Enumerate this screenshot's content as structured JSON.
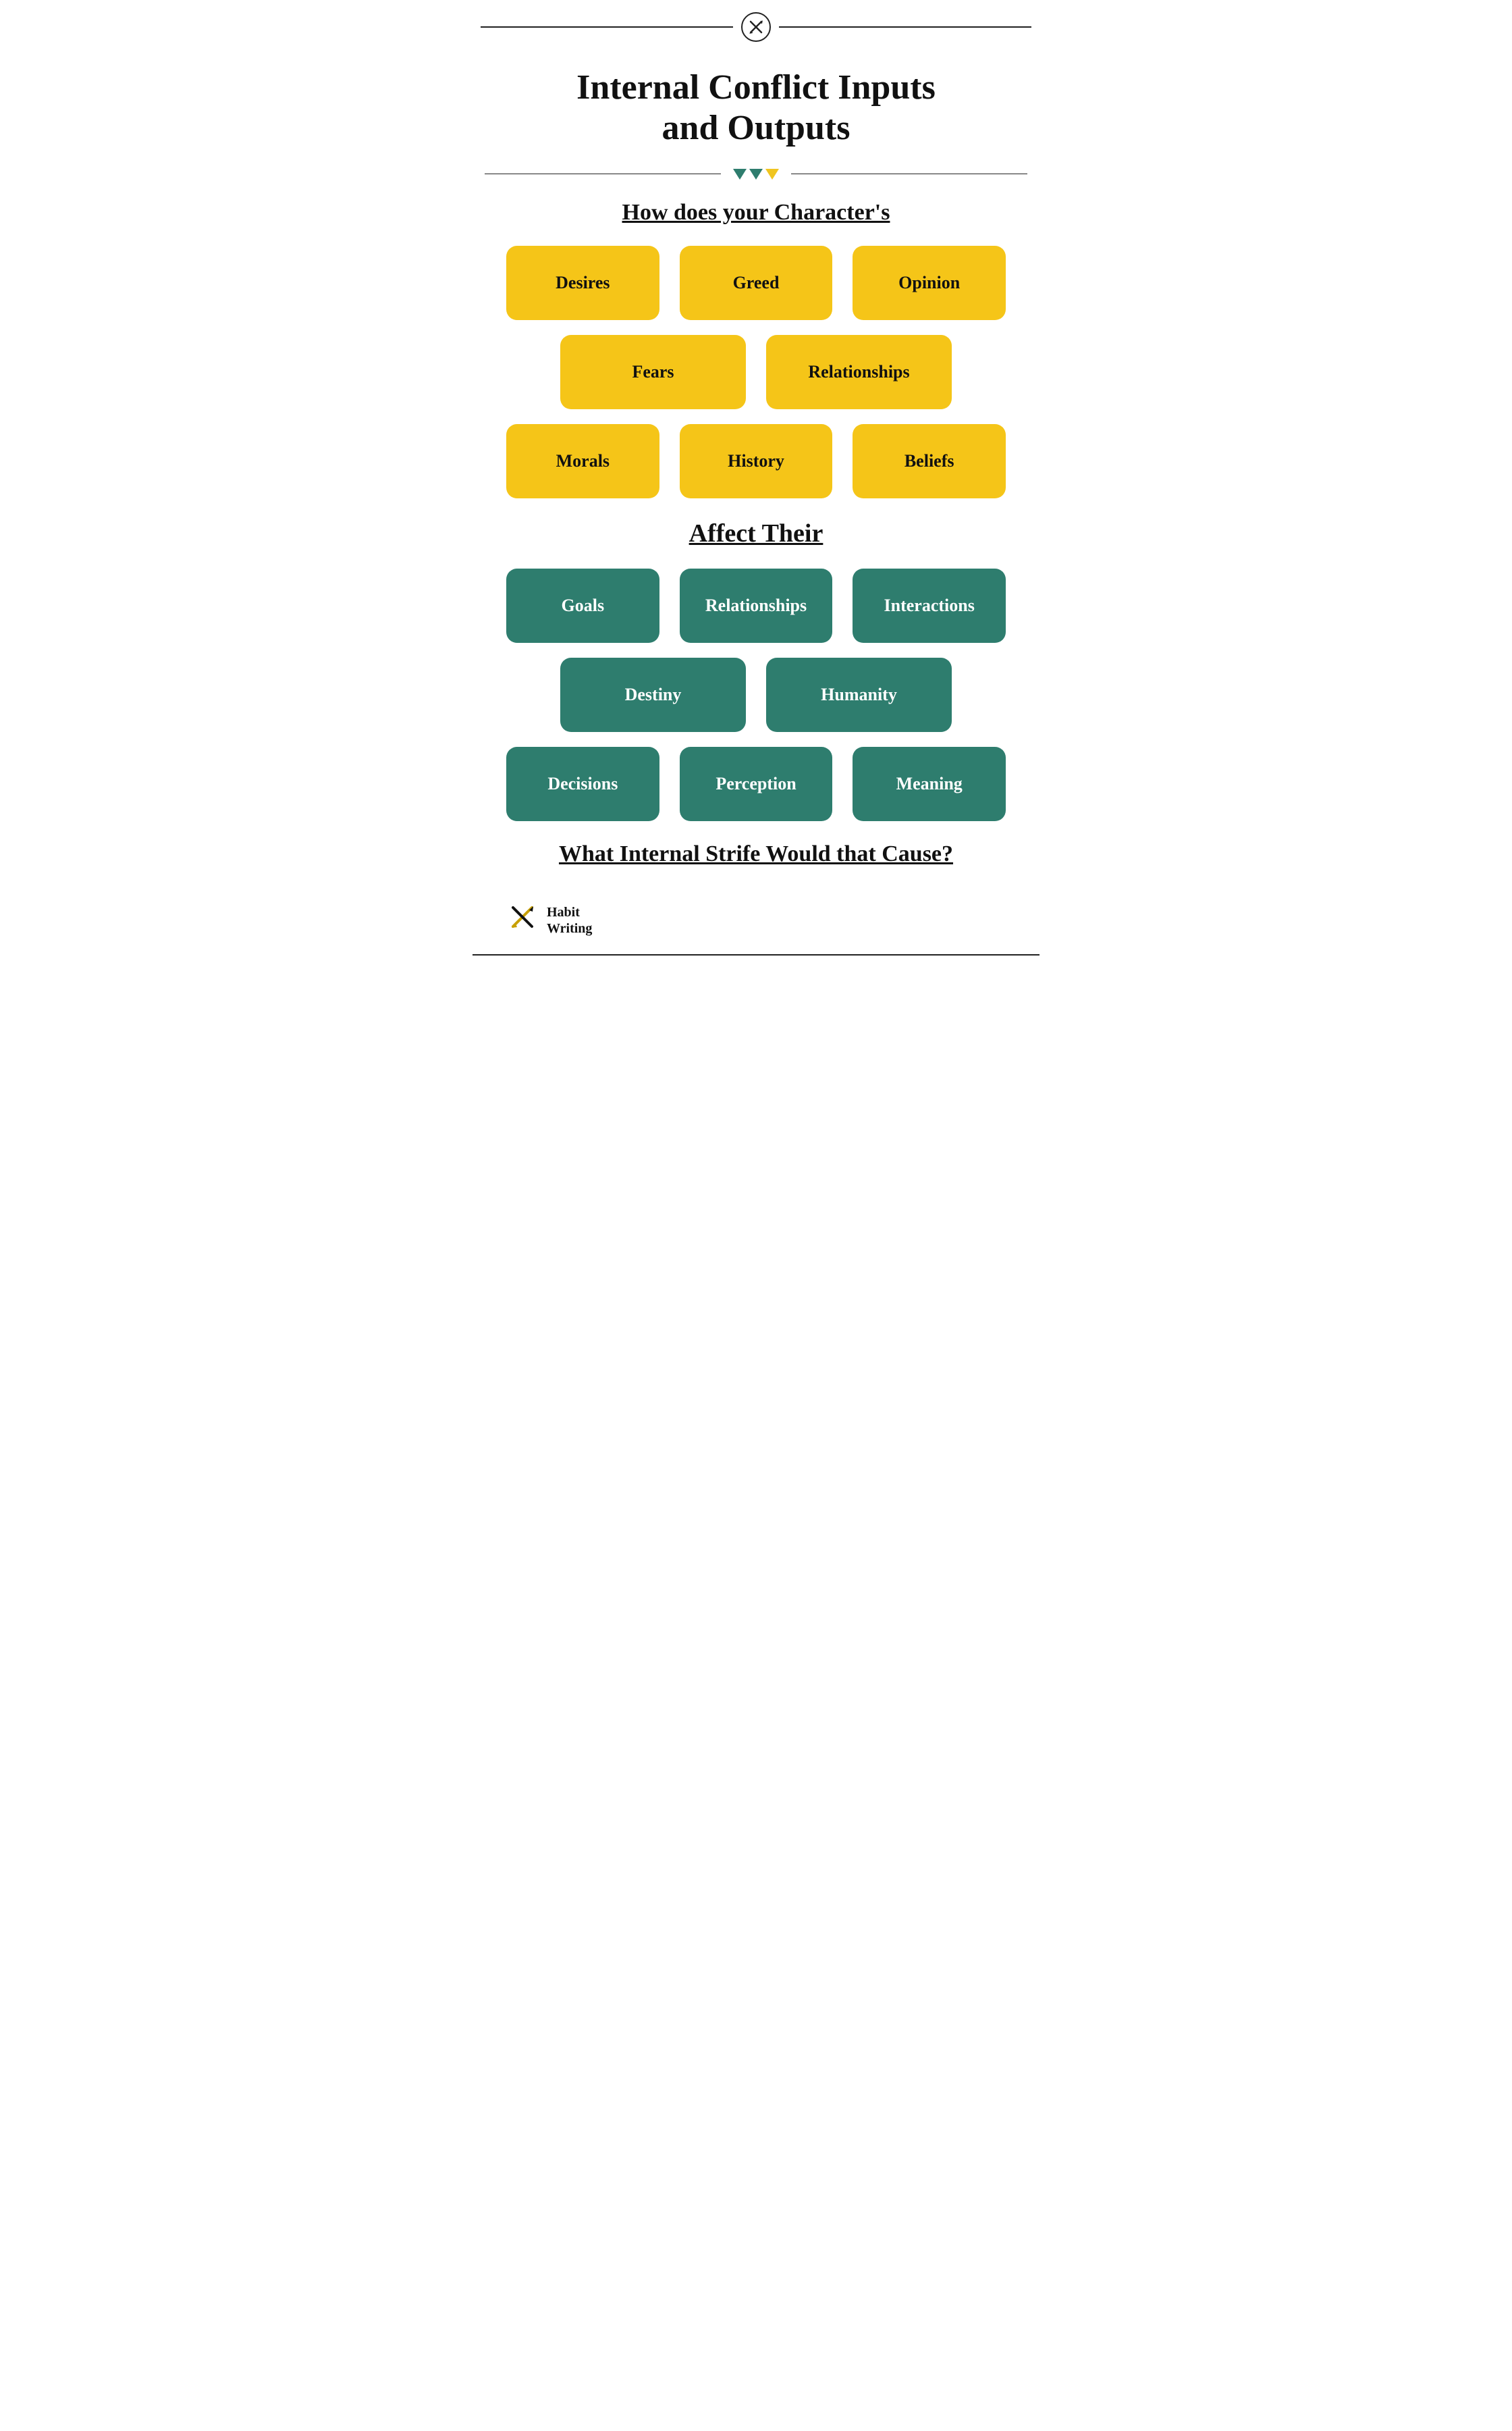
{
  "header": {
    "logo_symbol": "✕"
  },
  "title": {
    "line1": "Internal Conflict Inputs",
    "line2": "and Outputs"
  },
  "section1": {
    "heading": "How does your Character's"
  },
  "yellow_cards_row1": [
    {
      "label": "Desires"
    },
    {
      "label": "Greed"
    },
    {
      "label": "Opinion"
    }
  ],
  "yellow_cards_row2": [
    {
      "label": "Fears"
    },
    {
      "label": "Relationships"
    }
  ],
  "yellow_cards_row3": [
    {
      "label": "Morals"
    },
    {
      "label": "History"
    },
    {
      "label": "Beliefs"
    }
  ],
  "section2": {
    "heading": "Affect Their"
  },
  "teal_cards_row1": [
    {
      "label": "Goals"
    },
    {
      "label": "Relationships"
    },
    {
      "label": "Interactions"
    }
  ],
  "teal_cards_row2": [
    {
      "label": "Destiny"
    },
    {
      "label": "Humanity"
    }
  ],
  "teal_cards_row3": [
    {
      "label": "Decisions"
    },
    {
      "label": "Perception"
    },
    {
      "label": "Meaning"
    }
  ],
  "section3": {
    "heading": "What Internal Strife Would that Cause?"
  },
  "footer": {
    "brand_name": "Habit",
    "brand_name2": "Writing"
  }
}
